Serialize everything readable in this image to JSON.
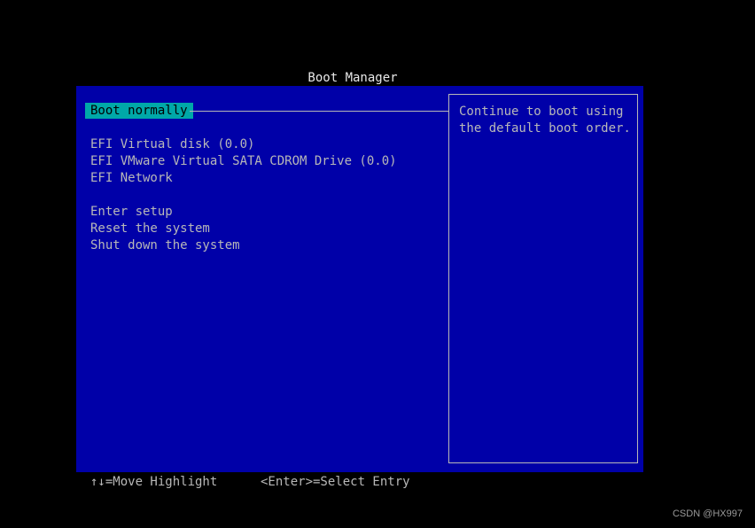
{
  "title": "Boot Manager",
  "menu": {
    "selected": "Boot normally",
    "boot_options": [
      "EFI Virtual disk (0.0)",
      "EFI VMware Virtual SATA CDROM Drive (0.0)",
      "EFI Network"
    ],
    "system_options": [
      "Enter setup",
      "Reset the system",
      "Shut down the system"
    ]
  },
  "help": {
    "lines": [
      "Continue to boot using",
      "the default boot order."
    ]
  },
  "footer": {
    "move_hint": "↑↓=Move Highlight",
    "select_hint": "<Enter>=Select Entry"
  },
  "watermark": "CSDN @HX997",
  "colors": {
    "background": "#000000",
    "panel": "#0000a8",
    "highlight": "#00a8a8",
    "text": "#b8b8b8"
  }
}
